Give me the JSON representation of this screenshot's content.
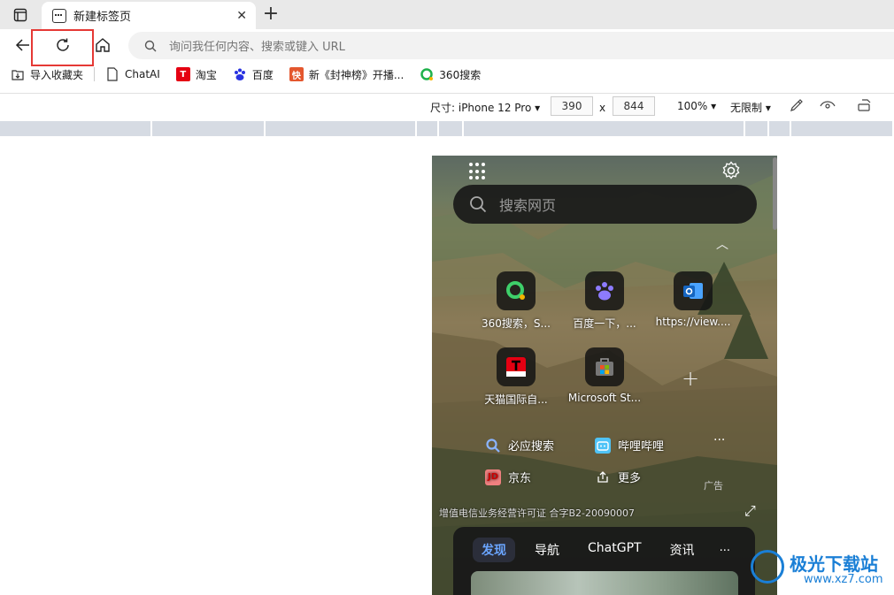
{
  "browser": {
    "tab_title": "新建标签页",
    "address_placeholder": "询问我任何内容、搜索或键入 URL"
  },
  "bookmarks": [
    {
      "label": "导入收藏夹",
      "icon": "import-icon"
    },
    {
      "label": "ChatAI",
      "icon": "page-icon"
    },
    {
      "label": "淘宝",
      "icon": "taobao-icon"
    },
    {
      "label": "百度",
      "icon": "baidu-icon"
    },
    {
      "label": "新《封神榜》开播...",
      "icon": "kuaishou-icon"
    },
    {
      "label": "360搜索",
      "icon": "360-icon"
    }
  ],
  "devtools": {
    "size_label": "尺寸: iPhone 12 Pro",
    "width": "390",
    "times": "x",
    "height": "844",
    "zoom": "100%",
    "throttle": "无限制"
  },
  "phone": {
    "search_placeholder": "搜索网页",
    "tiles": [
      {
        "label": "360搜索，S...",
        "icon": "360-icon"
      },
      {
        "label": "百度一下，...",
        "icon": "baidu-icon"
      },
      {
        "label": "https://view....",
        "icon": "outlook-icon"
      },
      {
        "label": "天猫国际自...",
        "icon": "tmall-icon"
      },
      {
        "label": "Microsoft St...",
        "icon": "store-icon"
      }
    ],
    "links": [
      {
        "label": "必应搜索"
      },
      {
        "label": "哔哩哔哩"
      },
      {
        "label": "京东",
        "badge": "JD"
      },
      {
        "label": "更多"
      }
    ],
    "ad_label": "广告",
    "icp": "增值电信业务经营许可证 合字B2-20090007",
    "feed_tabs": [
      "发现",
      "导航",
      "ChatGPT",
      "资讯"
    ],
    "feed_more": "..."
  },
  "watermark": {
    "name": "极光下载站",
    "url": "www.xz7.com"
  },
  "colors": {
    "highlight": "#e53935",
    "feed_active": "#6aa5ff"
  }
}
